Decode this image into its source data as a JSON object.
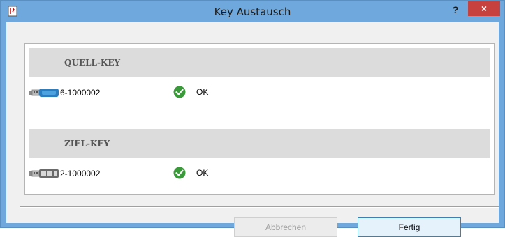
{
  "window": {
    "title": "Key Austausch",
    "help_label": "?",
    "close_label": "×"
  },
  "sections": [
    {
      "header": "QUELL-KEY",
      "item": {
        "key_id": "6-1000002",
        "status": "OK",
        "icon": "usb-key-blue-icon"
      }
    },
    {
      "header": "ZIEL-KEY",
      "item": {
        "key_id": "2-1000002",
        "status": "OK",
        "icon": "usb-key-gray-icon"
      }
    }
  ],
  "buttons": {
    "cancel_label": "Abbrechen",
    "done_label": "Fertig"
  },
  "colors": {
    "titlebar": "#6fa8dc",
    "close": "#c7413f",
    "ok_green": "#3a9a3a",
    "usb_blue": "#2b7fc0"
  }
}
